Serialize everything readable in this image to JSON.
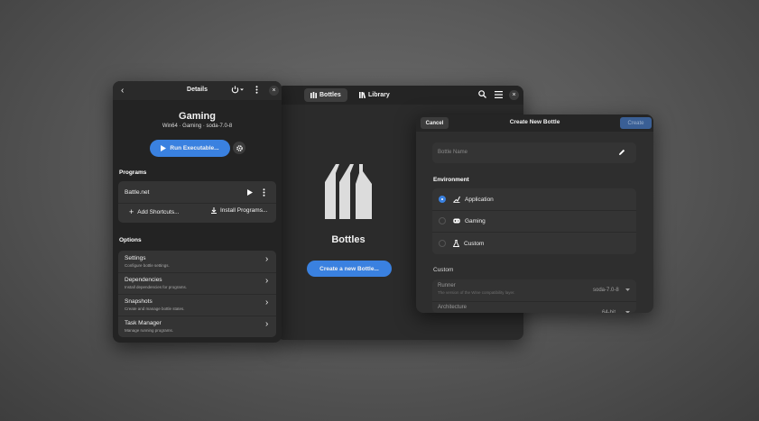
{
  "details": {
    "header_title": "Details",
    "bottle_name": "Gaming",
    "bottle_info": "Win64 · Gaming · soda-7.0-8",
    "run_label": "Run Executable...",
    "programs_title": "Programs",
    "program_name": "Battle.net",
    "add_shortcuts": "Add Shortcuts...",
    "install_programs": "Install Programs...",
    "options_title": "Options",
    "options": [
      {
        "title": "Settings",
        "subtitle": "Configure bottle settings."
      },
      {
        "title": "Dependencies",
        "subtitle": "Install dependencies for programs."
      },
      {
        "title": "Snapshots",
        "subtitle": "Create and manage bottle states."
      },
      {
        "title": "Task Manager",
        "subtitle": "Manage running programs."
      }
    ]
  },
  "main": {
    "tabs": [
      {
        "label": "Bottles"
      },
      {
        "label": "Library"
      }
    ],
    "title": "Bottles",
    "create_label": "Create a new Bottle..."
  },
  "dialog": {
    "cancel_label": "Cancel",
    "title": "Create New Bottle",
    "create_label": "Create",
    "name_placeholder": "Bottle Name",
    "environment_title": "Environment",
    "environments": [
      {
        "label": "Application",
        "selected": true
      },
      {
        "label": "Gaming",
        "selected": false
      },
      {
        "label": "Custom",
        "selected": false
      }
    ],
    "custom_title": "Custom",
    "runner_label": "Runner",
    "runner_subtitle": "The version of the Wine compatibility layer.",
    "runner_value": "soda-7.0-8",
    "architecture_label": "Architecture",
    "architecture_value": "64-bit"
  },
  "colors": {
    "accent": "#3a81e0",
    "window_bg": "#2b2b2b",
    "card_bg": "#343434"
  }
}
